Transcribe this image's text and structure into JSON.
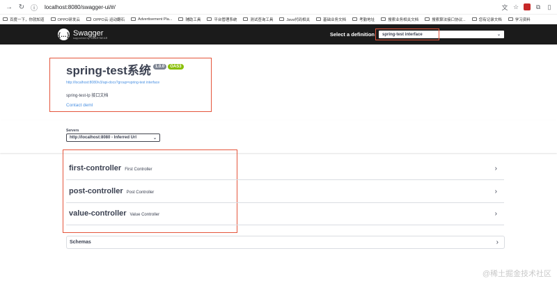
{
  "browser": {
    "url": "localhost:8080/swagger-ui/#/",
    "bookmarks": [
      "百度一下，你就知道",
      "OPPO研发云",
      "OPPO云·运动翻石",
      "Advertisement Pla...",
      "辅助工具",
      "平台管理系统",
      "测试查询工具",
      "Java代码相关",
      "基础业务文档",
      "考勤地址",
      "搜索业务相关文档",
      "搜索算法接口协议...",
      "您有记录文档",
      "学习资料"
    ]
  },
  "topbar": {
    "logo_text": "Swagger",
    "logo_sub": "supported by SMARTBEAR",
    "definition_label": "Select a definition",
    "definition_value": "spring-test interface"
  },
  "info": {
    "title": "spring-test系统",
    "version": "1.0.0",
    "oas": "OAS3",
    "url": "http://localhost:8080/v3/api-docs?group=spring-test interface",
    "description": "spring-test-lp 接口文档",
    "contact": "Contact deml"
  },
  "servers": {
    "label": "Servers",
    "selected": "http://localhost:8080 - Inferred Url"
  },
  "controllers": [
    {
      "name": "first-controller",
      "desc": "First Controller"
    },
    {
      "name": "post-controller",
      "desc": "Post Controller"
    },
    {
      "name": "value-controller",
      "desc": "Value Controller"
    }
  ],
  "schemas": {
    "label": "Schemas"
  },
  "watermark": "@稀土掘金技术社区",
  "colors": {
    "accent_red": "#e4543a",
    "topbar": "#1b1b1b",
    "oas_green": "#89bf04",
    "link": "#4990e2"
  }
}
